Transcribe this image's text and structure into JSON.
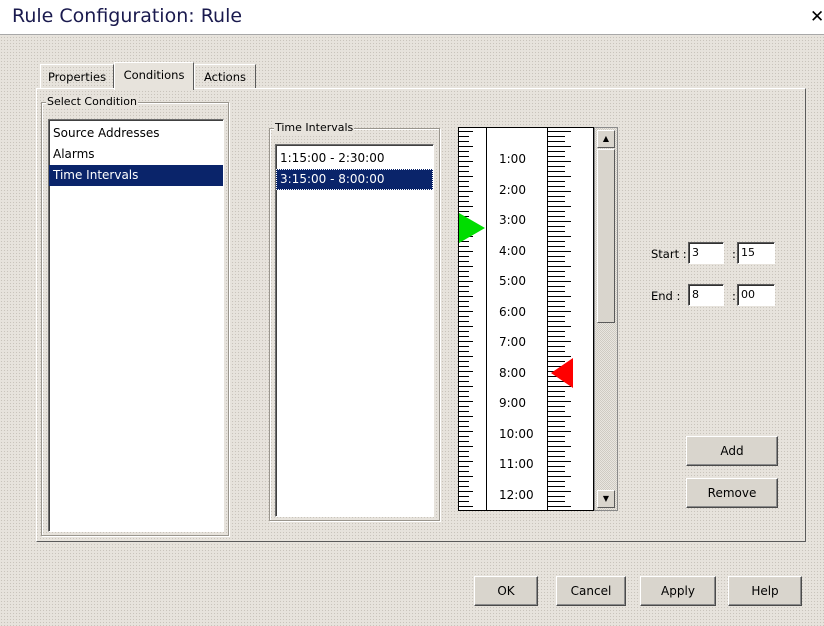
{
  "window": {
    "title": "Rule Configuration: Rule",
    "close_label": "✕"
  },
  "tabs": [
    {
      "label": "Properties",
      "active": false
    },
    {
      "label": "Conditions",
      "active": true
    },
    {
      "label": "Actions",
      "active": false
    }
  ],
  "select_condition": {
    "title": "Select Condition",
    "items": [
      "Source Addresses",
      "Alarms",
      "Time Intervals"
    ],
    "selected_index": 2
  },
  "time_intervals": {
    "title": "Time Intervals",
    "items": [
      "1:15:00 - 2:30:00",
      "3:15:00 - 8:00:00"
    ],
    "selected_index": 1
  },
  "ruler": {
    "hour_labels": [
      "1:00",
      "2:00",
      "3:00",
      "4:00",
      "5:00",
      "6:00",
      "7:00",
      "8:00",
      "9:00",
      "10:00",
      "11:00",
      "12:00"
    ],
    "start_marker_color": "#00dd00",
    "end_marker_color": "#ff0000",
    "start_hour": 3.25,
    "end_hour": 8.0
  },
  "start": {
    "label": "Start :",
    "hour": "3",
    "minute": "15",
    "separator": ":"
  },
  "end": {
    "label": "End :",
    "hour": "8",
    "minute": "00",
    "separator": ":"
  },
  "buttons": {
    "add": "Add",
    "remove": "Remove",
    "ok": "OK",
    "cancel": "Cancel",
    "apply": "Apply",
    "help": "Help"
  },
  "icons": {
    "scroll_up": "scroll-up-arrow-icon",
    "scroll_down": "scroll-down-arrow-icon",
    "close": "close-icon"
  }
}
